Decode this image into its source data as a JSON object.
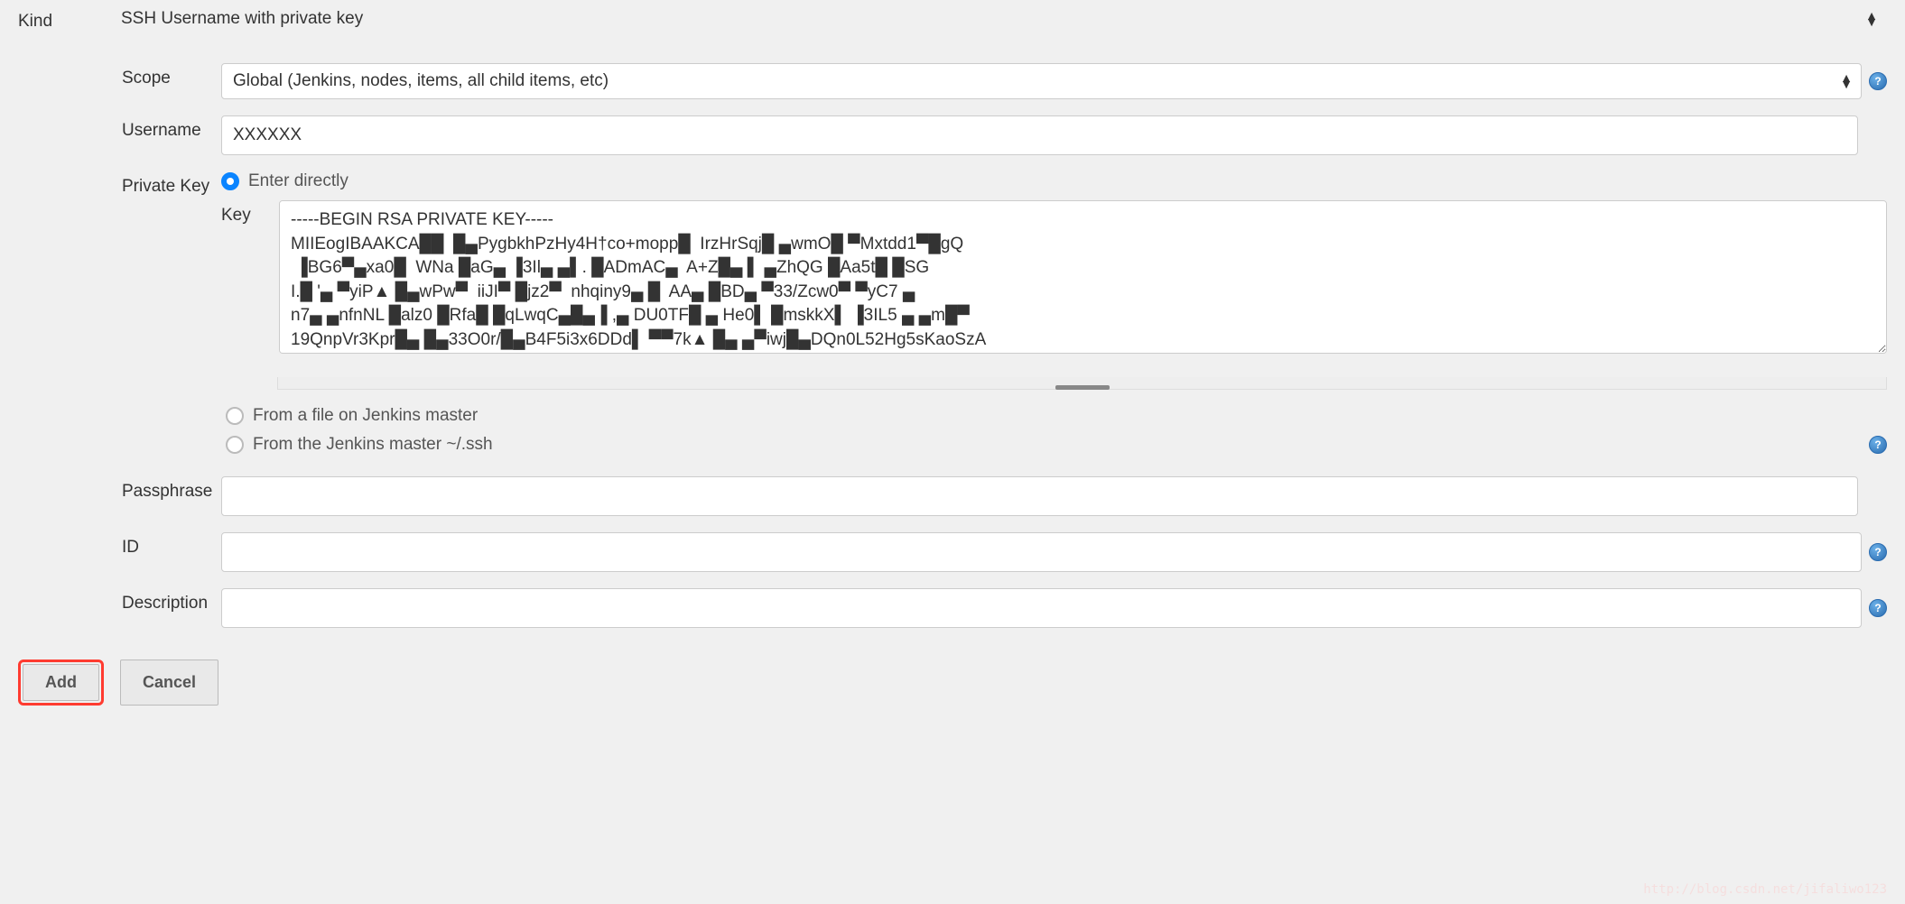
{
  "labels": {
    "kind": "Kind",
    "scope": "Scope",
    "username": "Username",
    "privateKey": "Private Key",
    "key": "Key",
    "passphrase": "Passphrase",
    "id": "ID",
    "description": "Description"
  },
  "values": {
    "kind": "SSH Username with private key",
    "scope": "Global (Jenkins, nodes, items, all child items, etc)",
    "username": "XXXXXX",
    "keyText": "-----BEGIN RSA PRIVATE KEY-----\nMIIEogIBAAKCA██  █▄PygbkhPzHy4H†co+mopp█  IrzHrSqj█ ▄wmO█ ▀Mxtdd1▀█gQ\n ▐BG6▀▄xa0█  WNa █aG▄ ▐3Il▄ ▄▌. █ADmAC▄  A+Z█▄ ▌ ▄ZhQG █Aa5t█ █SG\nI.█ '▄ ▀yiP▲ █▄wPw▀  iiJI▀ █jz2▀  nhqiny9▄ █  AA▄ █BD▄ ▀33/Zcw0▀ ▀yC7 ▄\nn7▄ ▄nfnNL █alz0 █Rfa█ █qLwqC▄█▄▐ ,▄ DU0TF█ ▄ He0▌ █mskkX▌ ▐3IL5 ▄ ▄m█▀\n19QnpVr3Kpr█▄ █▄33O0r/█▄B4F5i3x6DDd▌ ▀▀7k▲ █▄ ▄▀iwj█▄DQn0L52Hg5sKaoSzA",
    "passphrase": "",
    "id": "",
    "description": ""
  },
  "radio": {
    "enterDirectly": "Enter directly",
    "fromFile": "From a file on Jenkins master",
    "fromSsh": "From the Jenkins master ~/.ssh"
  },
  "buttons": {
    "add": "Add",
    "cancel": "Cancel"
  },
  "helpGlyph": "?",
  "watermark": "http://blog.csdn.net/jifaliwo123"
}
